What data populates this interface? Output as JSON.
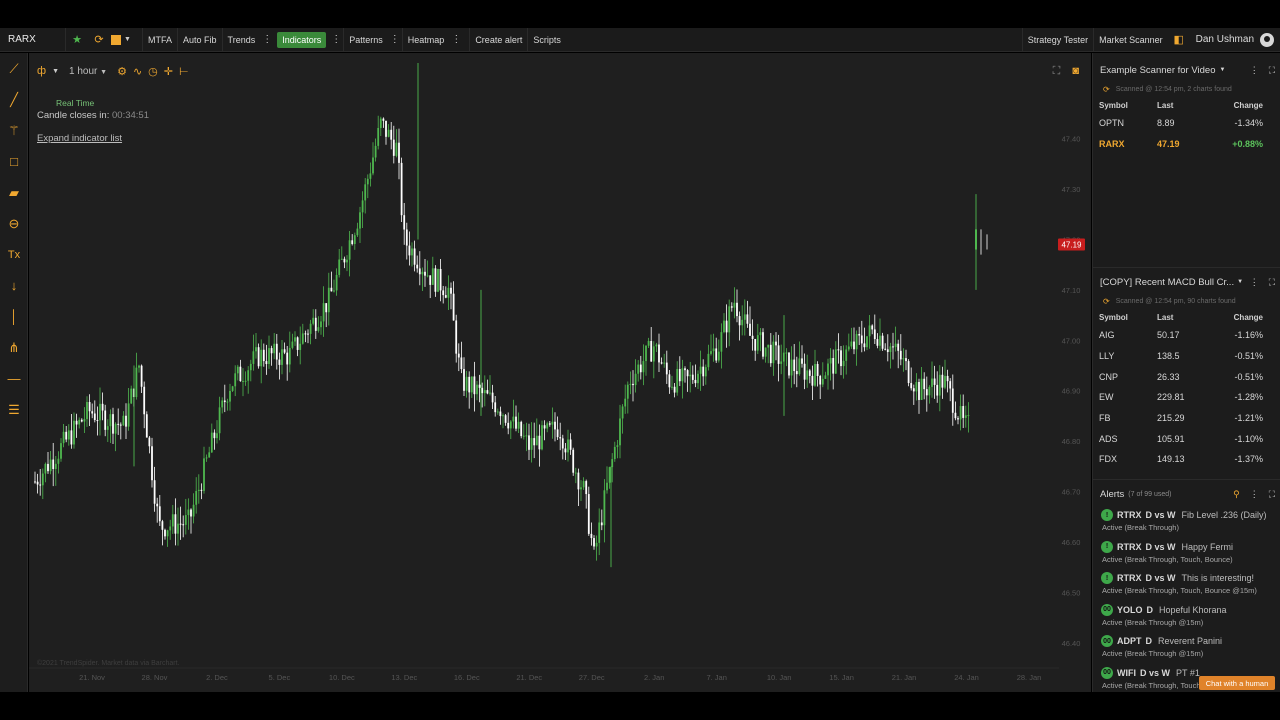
{
  "topbar": {
    "symbol": "RARX",
    "buttons": [
      "MTFA",
      "Auto Fib",
      "Trends",
      "Indicators",
      "Patterns",
      "Heatmap",
      "Create alert",
      "Scripts"
    ],
    "right_buttons": [
      "Strategy Tester",
      "Market Scanner"
    ],
    "user": "Dan Ushman"
  },
  "chart": {
    "interval": "1 hour",
    "realtime_label": "Real Time",
    "candle_closes_label": "Candle closes in:",
    "candle_closes_time": "00:34:51",
    "expand_label": "Expand indicator list",
    "copyright": "©2021 TrendSpider. Market data via Barchart.",
    "price_tag": "47.19",
    "accent_up": "#4fb84f",
    "accent_down": "#ffffff",
    "price_tag_color": "#c81e1e"
  },
  "chart_data": {
    "type": "candlestick",
    "y_ticks": [
      "47.40",
      "47.30",
      "47.20",
      "47.10",
      "47.00",
      "46.90",
      "46.80",
      "46.70",
      "46.60",
      "46.50",
      "46.40"
    ],
    "x_ticks": [
      "21. Nov",
      "28. Nov",
      "2. Dec",
      "5. Dec",
      "10. Dec",
      "13. Dec",
      "16. Dec",
      "21. Dec",
      "27. Dec",
      "2. Jan",
      "7. Jan",
      "10. Jan",
      "15. Jan",
      "21. Jan",
      "24. Jan",
      "28. Jan"
    ],
    "ylim": [
      46.35,
      47.55
    ],
    "last_price": 47.19
  },
  "scanner1": {
    "title": "Example Scanner for Video",
    "scanned": "Scanned @ 12:54 pm, 2 charts found",
    "headers": [
      "Symbol",
      "Last",
      "Change"
    ],
    "rows": [
      {
        "symbol": "OPTN",
        "last": "8.89",
        "change": "-1.34%",
        "dir": "neg"
      },
      {
        "symbol": "RARX",
        "last": "47.19",
        "change": "+0.88%",
        "dir": "pos",
        "highlight": true
      }
    ]
  },
  "scanner2": {
    "title": "[COPY] Recent MACD Bull Cr...",
    "scanned": "Scanned @ 12:54 pm, 90 charts found",
    "headers": [
      "Symbol",
      "Last",
      "Change"
    ],
    "rows": [
      {
        "symbol": "AIG",
        "last": "50.17",
        "change": "-1.16%",
        "dir": "neg"
      },
      {
        "symbol": "LLY",
        "last": "138.5",
        "change": "-0.51%",
        "dir": "neg"
      },
      {
        "symbol": "CNP",
        "last": "26.33",
        "change": "-0.51%",
        "dir": "neg"
      },
      {
        "symbol": "EW",
        "last": "229.81",
        "change": "-1.28%",
        "dir": "neg"
      },
      {
        "symbol": "FB",
        "last": "215.29",
        "change": "-1.21%",
        "dir": "neg"
      },
      {
        "symbol": "ADS",
        "last": "105.91",
        "change": "-1.10%",
        "dir": "neg"
      },
      {
        "symbol": "FDX",
        "last": "149.13",
        "change": "-1.37%",
        "dir": "neg"
      }
    ]
  },
  "alerts": {
    "title": "Alerts",
    "count": "(7 of 99 used)",
    "items": [
      {
        "badge": "!",
        "symbol": "RTRX",
        "tf": "D vs W",
        "name": "Fib Level .236 (Daily)",
        "status": "Active (Break Through)"
      },
      {
        "badge": "!",
        "symbol": "RTRX",
        "tf": "D vs W",
        "name": "Happy Fermi",
        "status": "Active (Break Through, Touch, Bounce)"
      },
      {
        "badge": "!",
        "symbol": "RTRX",
        "tf": "D vs W",
        "name": "This is interesting!",
        "status": "Active (Break Through, Touch, Bounce @15m)"
      },
      {
        "badge": "00",
        "symbol": "YOLO",
        "tf": "D",
        "name": "Hopeful Khorana",
        "status": "Active (Break Through @15m)"
      },
      {
        "badge": "00",
        "symbol": "ADPT",
        "tf": "D",
        "name": "Reverent Panini",
        "status": "Active (Break Through @15m)"
      },
      {
        "badge": "00",
        "symbol": "WIFI",
        "tf": "D vs W",
        "name": "PT #1",
        "status": "Active (Break Through, Touch..."
      }
    ]
  },
  "chat_button": "Chat with a human"
}
